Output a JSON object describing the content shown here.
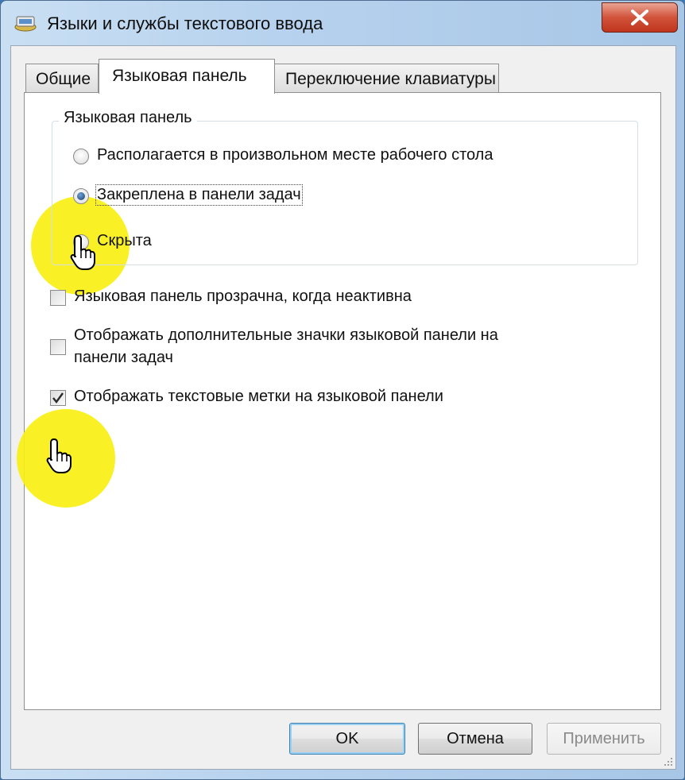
{
  "window": {
    "title": "Языки и службы текстового ввода",
    "close_symbol": "✕"
  },
  "tabs": [
    {
      "label": "Общие",
      "active": false
    },
    {
      "label": "Языковая панель",
      "active": true
    },
    {
      "label": "Переключение клавиатуры",
      "active": false
    }
  ],
  "language_bar_group": {
    "legend": "Языковая панель",
    "options": [
      {
        "label": "Располагается в произвольном месте рабочего стола",
        "selected": false
      },
      {
        "label": "Закреплена в панели задач",
        "selected": true
      },
      {
        "label": "Скрыта",
        "selected": false
      }
    ]
  },
  "checkboxes": {
    "transparent": {
      "label": "Языковая панель прозрачна, когда неактивна",
      "checked": false
    },
    "extra_icons": {
      "line1": "Отображать дополнительные значки языковой панели на",
      "line2": "панели задач",
      "checked": false
    },
    "text_labels": {
      "label": "Отображать текстовые метки на языковой панели",
      "checked": true
    }
  },
  "buttons": {
    "ok": "OK",
    "cancel": "Отмена",
    "apply": "Применить"
  },
  "colors": {
    "highlight": "#f8f014",
    "close_button": "#c0351d",
    "default_button_border": "#3c7fb1"
  }
}
